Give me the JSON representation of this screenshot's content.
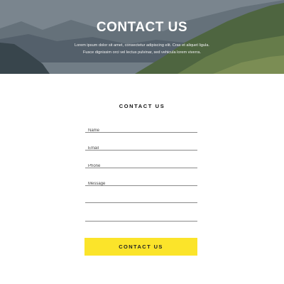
{
  "hero": {
    "title": "CONTACT US",
    "subtitle_line1": "Lorem ipsum dolor sit amet, consectetur adipiscing elit. Cras et aliquet ligula.",
    "subtitle_line2": "Fusce dignissim orci vel lectus pulvinar, sed vehicula lorem viverra."
  },
  "form": {
    "title": "CONTACT US",
    "name_placeholder": "Name",
    "email_placeholder": "Email",
    "phone_placeholder": "Phone",
    "message_placeholder": "Message",
    "submit_label": "CONTACT US",
    "accent_color": "#fbe42a"
  }
}
